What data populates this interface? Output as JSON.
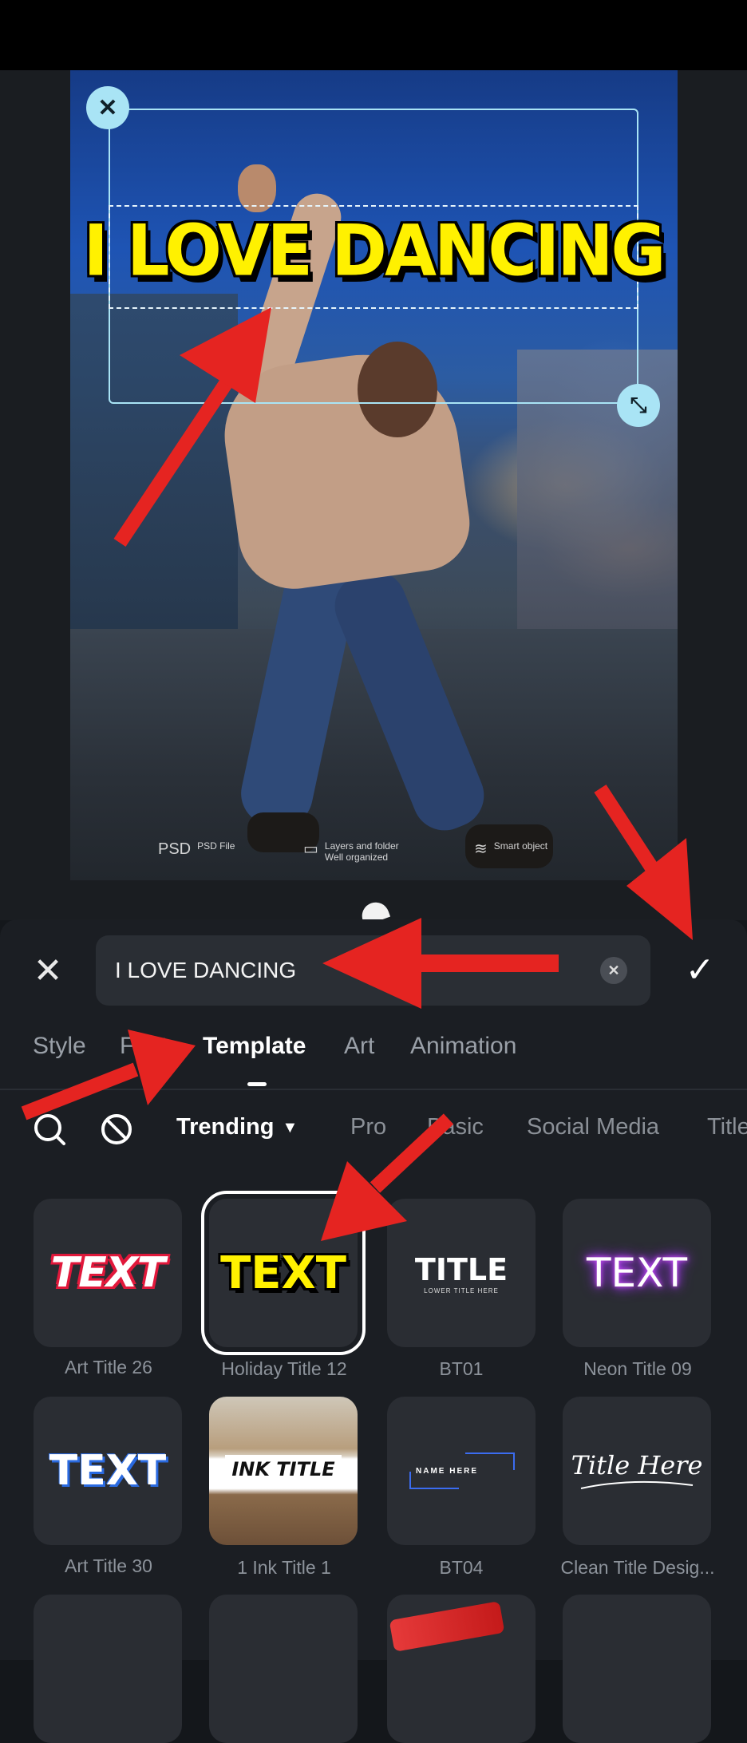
{
  "overlay": {
    "title_text": "I LOVE DANCING"
  },
  "watermarks": [
    {
      "glyph": "PSD",
      "text": "PSD File"
    },
    {
      "glyph": "▭",
      "text": "Layers and folder\nWell organized"
    },
    {
      "glyph": "≋",
      "text": "Smart object"
    }
  ],
  "editor": {
    "input_value": "I LOVE DANCING",
    "tabs": [
      {
        "label": "Style",
        "active": false
      },
      {
        "label": "Font",
        "active": false
      },
      {
        "label": "Template",
        "active": true
      },
      {
        "label": "Art",
        "active": false
      },
      {
        "label": "Animation",
        "active": false
      }
    ],
    "categories": [
      {
        "label": "Trending",
        "active": true
      },
      {
        "label": "Pro",
        "active": false
      },
      {
        "label": "Basic",
        "active": false
      },
      {
        "label": "Social Media",
        "active": false
      },
      {
        "label": "Title",
        "active": false
      }
    ]
  },
  "templates": [
    {
      "name": "Art Title 26",
      "preview": "TEXT",
      "style": "red-white"
    },
    {
      "name": "Holiday Title 12",
      "preview": "TEXT",
      "style": "yellow-black",
      "selected": true
    },
    {
      "name": "BT01",
      "preview": "TITLE",
      "sub": "LOWER TITLE HERE",
      "style": "plain-white"
    },
    {
      "name": "Neon Title 09",
      "preview": "TEXT",
      "style": "neon-purple"
    },
    {
      "name": "Art Title 30",
      "preview": "TEXT",
      "style": "white-blue"
    },
    {
      "name": "1 Ink Title 1",
      "preview": "INK TITLE",
      "style": "ink"
    },
    {
      "name": "BT04",
      "preview": "NAME HERE",
      "style": "lower-third"
    },
    {
      "name": "Clean Title Desig...",
      "preview": "Title Here",
      "style": "script"
    }
  ],
  "colors": {
    "accent_cyan": "#a9e4f5",
    "arrow_red": "#e52421",
    "overlay_yellow": "#fff100"
  }
}
